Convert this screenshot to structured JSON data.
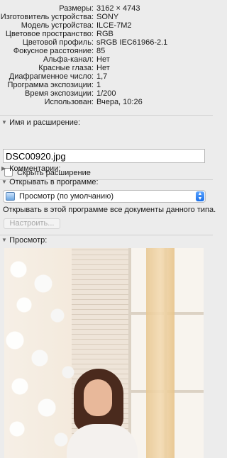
{
  "info": [
    {
      "key": "Размеры:",
      "value": "3162 × 4743"
    },
    {
      "key": "Изготовитель устройства:",
      "value": "SONY"
    },
    {
      "key": "Модель устройства:",
      "value": "ILCE-7M2"
    },
    {
      "key": "Цветовое пространство:",
      "value": "RGB"
    },
    {
      "key": "Цветовой профиль:",
      "value": "sRGB IEC61966-2.1"
    },
    {
      "key": "Фокусное расстояние:",
      "value": "85"
    },
    {
      "key": "Альфа-канал:",
      "value": "Нет"
    },
    {
      "key": "Красные глаза:",
      "value": "Нет"
    },
    {
      "key": "Диафрагменное число:",
      "value": "1,7"
    },
    {
      "key": "Программа экспозиции:",
      "value": "1"
    },
    {
      "key": "Время экспозиции:",
      "value": "1/200"
    },
    {
      "key": "Использован:",
      "value": "Вчера, 10:26"
    }
  ],
  "name_section": {
    "title": "Имя и расширение:",
    "filename": "DSC00920.jpg",
    "hide_extension_label": "Скрыть расширение",
    "hide_extension_checked": false
  },
  "comments": {
    "title": "Комментарии:"
  },
  "open_with": {
    "title": "Открывать в программе:",
    "app_label": "Просмотр (по умолчанию)",
    "description": "Открывать в этой программе все документы данного типа.",
    "configure_button": "Настроить..."
  },
  "preview": {
    "title": "Просмотр:"
  }
}
